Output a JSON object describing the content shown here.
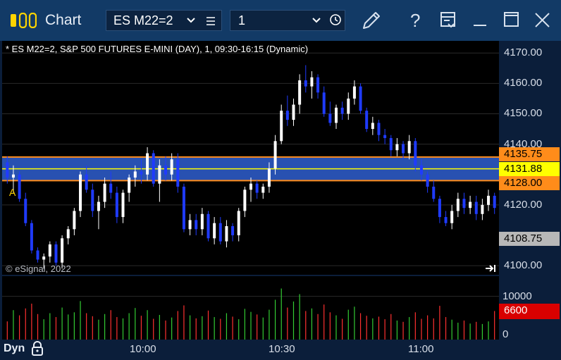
{
  "window": {
    "title": "Chart",
    "symbol_selector": "ES M22=2",
    "interval_selector": "1"
  },
  "chart": {
    "header": "* ES M22=2, S&P 500 FUTURES E-MINI (DAY), 1, 09:30-16:15 (Dynamic)",
    "copyright": "© eSignal, 2022",
    "marker_label": "A",
    "price_axis": {
      "ticks": [
        "4170.00",
        "4160.00",
        "4150.00",
        "4140.00",
        "4120.00",
        "4100.00"
      ],
      "tick_values": [
        4170,
        4160,
        4150,
        4140,
        4120,
        4100
      ],
      "range": [
        4097,
        4174
      ]
    },
    "price_tags": [
      {
        "label": "4135.75",
        "value": 4135.75,
        "bg": "#ff8c1a",
        "fg": "#000000"
      },
      {
        "label": "4131.88",
        "value": 4131.88,
        "bg": "#ffff00",
        "fg": "#000000"
      },
      {
        "label": "4128.00",
        "value": 4128.0,
        "bg": "#ff8c1a",
        "fg": "#000000"
      },
      {
        "label": "4108.75",
        "value": 4108.75,
        "bg": "#b8b8b8",
        "fg": "#000000"
      }
    ],
    "band": {
      "upper": 4135.75,
      "lower": 4128.0,
      "mid": 4131.88,
      "color": "#2f5fd0"
    },
    "volume_axis": {
      "ticks": [
        "10000",
        "0"
      ],
      "tick_values": [
        10000,
        0
      ],
      "range": [
        0,
        14000
      ]
    },
    "volume_tag": {
      "label": "6600",
      "value": 6600,
      "bg": "#d90000",
      "fg": "#ffffff"
    },
    "time_axis": {
      "labels": [
        "10:00",
        "10:30",
        "11:00"
      ]
    },
    "footer": {
      "dyn_label": "Dyn"
    }
  },
  "chart_data": {
    "type": "candlestick",
    "interval_minutes": 1,
    "price_range": [
      4097,
      4174
    ],
    "series": [
      {
        "name": "price",
        "values": [
          [
            4134,
            4136,
            4127,
            4129
          ],
          [
            4129,
            4133,
            4124,
            4130
          ],
          [
            4130,
            4131,
            4121,
            4122
          ],
          [
            4122,
            4124,
            4113,
            4114
          ],
          [
            4114,
            4115,
            4104,
            4105
          ],
          [
            4105,
            4106,
            4101,
            4102
          ],
          [
            4102,
            4104,
            4099,
            4103
          ],
          [
            4103,
            4108,
            4101,
            4107
          ],
          [
            4107,
            4108,
            4100,
            4101
          ],
          [
            4101,
            4110,
            4099,
            4109
          ],
          [
            4109,
            4113,
            4107,
            4112
          ],
          [
            4112,
            4119,
            4110,
            4118
          ],
          [
            4118,
            4131,
            4116,
            4130
          ],
          [
            4130,
            4133,
            4124,
            4125
          ],
          [
            4125,
            4127,
            4116,
            4118
          ],
          [
            4118,
            4123,
            4112,
            4121
          ],
          [
            4121,
            4129,
            4119,
            4127
          ],
          [
            4127,
            4131,
            4122,
            4124
          ],
          [
            4124,
            4126,
            4114,
            4116
          ],
          [
            4116,
            4125,
            4114,
            4124
          ],
          [
            4124,
            4130,
            4121,
            4129
          ],
          [
            4129,
            4133,
            4126,
            4131
          ],
          [
            4131,
            4135,
            4127,
            4130
          ],
          [
            4130,
            4139,
            4128,
            4137
          ],
          [
            4137,
            4138,
            4126,
            4127
          ],
          [
            4127,
            4135,
            4121,
            4133
          ],
          [
            4133,
            4136,
            4128,
            4130
          ],
          [
            4130,
            4137,
            4128,
            4135
          ],
          [
            4135,
            4137,
            4124,
            4126
          ],
          [
            4126,
            4127,
            4111,
            4112
          ],
          [
            4112,
            4117,
            4110,
            4115
          ],
          [
            4115,
            4117,
            4110,
            4112
          ],
          [
            4112,
            4119,
            4110,
            4117
          ],
          [
            4117,
            4118,
            4108,
            4109
          ],
          [
            4109,
            4116,
            4107,
            4114
          ],
          [
            4114,
            4116,
            4107,
            4108
          ],
          [
            4108,
            4115,
            4106,
            4113
          ],
          [
            4113,
            4114,
            4108,
            4110
          ],
          [
            4110,
            4119,
            4108,
            4118
          ],
          [
            4118,
            4126,
            4116,
            4125
          ],
          [
            4125,
            4129,
            4121,
            4127
          ],
          [
            4127,
            4128,
            4122,
            4124
          ],
          [
            4124,
            4127,
            4122,
            4126
          ],
          [
            4126,
            4134,
            4124,
            4132
          ],
          [
            4132,
            4143,
            4130,
            4141
          ],
          [
            4141,
            4153,
            4140,
            4151
          ],
          [
            4151,
            4156,
            4146,
            4148
          ],
          [
            4148,
            4155,
            4146,
            4153
          ],
          [
            4153,
            4163,
            4150,
            4161
          ],
          [
            4161,
            4166,
            4157,
            4159
          ],
          [
            4159,
            4164,
            4155,
            4162
          ],
          [
            4162,
            4163,
            4155,
            4157
          ],
          [
            4157,
            4159,
            4149,
            4150
          ],
          [
            4150,
            4154,
            4146,
            4147
          ],
          [
            4147,
            4153,
            4145,
            4152
          ],
          [
            4152,
            4154,
            4148,
            4150
          ],
          [
            4150,
            4157,
            4148,
            4155
          ],
          [
            4155,
            4161,
            4153,
            4159
          ],
          [
            4159,
            4160,
            4150,
            4151
          ],
          [
            4151,
            4152,
            4144,
            4145
          ],
          [
            4145,
            4149,
            4143,
            4147
          ],
          [
            4147,
            4148,
            4141,
            4143
          ],
          [
            4143,
            4145,
            4140,
            4142
          ],
          [
            4142,
            4143,
            4136,
            4138
          ],
          [
            4138,
            4142,
            4136,
            4140
          ],
          [
            4140,
            4141,
            4135,
            4137
          ],
          [
            4137,
            4143,
            4135,
            4141
          ],
          [
            4141,
            4142,
            4131,
            4133
          ],
          [
            4133,
            4135,
            4128,
            4130
          ],
          [
            4130,
            4131,
            4124,
            4126
          ],
          [
            4126,
            4128,
            4121,
            4122
          ],
          [
            4122,
            4123,
            4114,
            4116
          ],
          [
            4116,
            4118,
            4113,
            4114
          ],
          [
            4114,
            4120,
            4112,
            4118
          ],
          [
            4118,
            4124,
            4116,
            4122
          ],
          [
            4122,
            4124,
            4117,
            4119
          ],
          [
            4119,
            4123,
            4117,
            4121
          ],
          [
            4121,
            4123,
            4115,
            4117
          ],
          [
            4117,
            4122,
            4115,
            4120
          ],
          [
            4120,
            4125,
            4118,
            4123
          ],
          [
            4123,
            4124,
            4117,
            4119
          ]
        ]
      }
    ],
    "volume": [
      4200,
      6800,
      5600,
      7200,
      8300,
      5900,
      4700,
      6100,
      5200,
      7400,
      5800,
      6300,
      8900,
      6100,
      5400,
      4600,
      5900,
      6800,
      5200,
      4900,
      6100,
      7300,
      5500,
      6800,
      4800,
      5700,
      4400,
      5100,
      6600,
      7900,
      5600,
      4900,
      5400,
      6700,
      5200,
      4800,
      6100,
      5300,
      4700,
      7100,
      6400,
      5800,
      5100,
      6900,
      9200,
      11800,
      7400,
      8800,
      10500,
      6600,
      7200,
      5900,
      8100,
      6300,
      5600,
      4800,
      6900,
      7600,
      6100,
      5500,
      4900,
      5300,
      4700,
      5900,
      4400,
      4100,
      5200,
      6300,
      4800,
      5600,
      4900,
      7800,
      5200,
      4600,
      3900,
      4400,
      3700,
      4100,
      3600,
      4200,
      6600
    ],
    "volume_range": [
      0,
      14000
    ]
  }
}
